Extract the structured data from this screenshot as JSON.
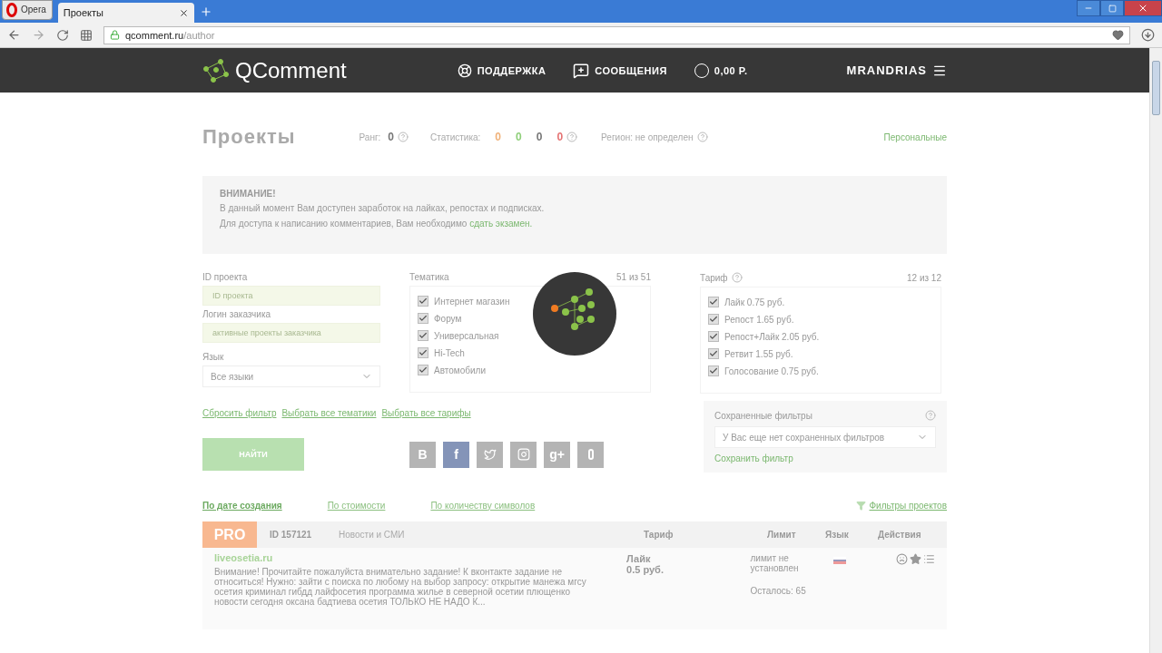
{
  "browser": {
    "menu_label": "Opera",
    "tabs": [
      {
        "title": "Проекты",
        "selected": true
      }
    ],
    "url_host": "qcomment.ru",
    "url_path": "/author"
  },
  "header": {
    "logo": "QComment",
    "nav": [
      {
        "kind": "support",
        "label": "ПОДДЕРЖКА"
      },
      {
        "kind": "messages",
        "label": "СООБЩЕНИЯ"
      },
      {
        "kind": "balance",
        "label": "0,00 Р."
      }
    ],
    "user": "MRANDRIAS"
  },
  "page": {
    "title": "Проекты",
    "rank_label": "Ранг:",
    "rank": "0",
    "stats_label": "Статистика:",
    "stats": [
      {
        "value": "0",
        "color": "#f0b27a"
      },
      {
        "value": "0",
        "color": "#8fcf7a"
      },
      {
        "value": "0",
        "color": "#777777"
      },
      {
        "value": "0",
        "color": "#e57373"
      }
    ],
    "region": "Регион: не определен",
    "personal_link": "Персональные"
  },
  "notice": {
    "title": "ВНИМАНИЕ!",
    "lines": [
      "В данный момент Вам доступен заработок на лайках, репостах и подписках.",
      "Для доступа к написанию комментариев, Вам необходимо"
    ],
    "link": "сдать экзамен."
  },
  "filters": {
    "id_label": "ID проекта",
    "id_placeholder": "ID проекта",
    "login_label": "Логин заказчика",
    "login_placeholder": "активные проекты заказчика",
    "lang_label": "Язык",
    "lang_value": "Все языки",
    "topics_label": "Тематика",
    "topics_count": "51 из 51",
    "topics": [
      {
        "label": "Интернет магазин",
        "checked": true
      },
      {
        "label": "Форум",
        "checked": true
      },
      {
        "label": "Универсальная",
        "checked": true
      },
      {
        "label": "Hi-Tech",
        "checked": true
      },
      {
        "label": "Автомобили",
        "checked": true
      }
    ],
    "tariffs_label": "Тариф",
    "tariffs_count": "12 из 12",
    "tariffs": [
      {
        "label": "Лайк 0.75 руб.",
        "checked": true
      },
      {
        "label": "Репост 1.65 руб.",
        "checked": true
      },
      {
        "label": "Репост+Лайк 2.05 руб.",
        "checked": true
      },
      {
        "label": "Ретвит 1.55 руб.",
        "checked": true
      },
      {
        "label": "Голосование 0.75 руб.",
        "checked": true
      }
    ],
    "links": [
      "Сбросить фильтр",
      "Выбрать все тематики",
      "Выбрать все тарифы"
    ],
    "find_button": "НАЙТИ",
    "socials": [
      {
        "kind": "vk",
        "label": "B",
        "selected": false
      },
      {
        "kind": "fb",
        "label": "f",
        "selected": true
      },
      {
        "kind": "tw",
        "selected": false
      },
      {
        "kind": "ig",
        "selected": false
      },
      {
        "kind": "gp",
        "label": "g+",
        "selected": false
      },
      {
        "kind": "ok",
        "selected": false
      }
    ],
    "saved_title": "Сохраненные фильтры",
    "saved_value": "У Вас еще нет сохраненных фильтров",
    "save_link": "Сохранить фильтр"
  },
  "sort": [
    {
      "label": "По дате создания",
      "selected": true
    },
    {
      "label": "По стоимости",
      "selected": false
    },
    {
      "label": "По количеству символов",
      "selected": false
    }
  ],
  "filters_link": "Фильтры проектов",
  "project": {
    "badge": "PRO",
    "id": "ID 157121",
    "category": "Новости и СМИ",
    "columns": [
      "Тариф",
      "Лимит",
      "Язык",
      "Действия"
    ],
    "site": "liveosetia.ru",
    "description": "Внимание! Прочитайте пожалуйста внимательно задание! К вконтакте задание не относиться! Нужно: зайти с поиска по любому на выбор запросу: открытие манежа мгсу осетия криминал гибдд лайфосетия программа жилье в северной осетии плющенко новости сегодня оксана бадтиева осетия ТОЛЬКО НЕ НАДО К...",
    "tariff": "Лайк",
    "price": "0.5 руб.",
    "limit": "лимит не установлен",
    "remaining": "Осталось: 65"
  }
}
